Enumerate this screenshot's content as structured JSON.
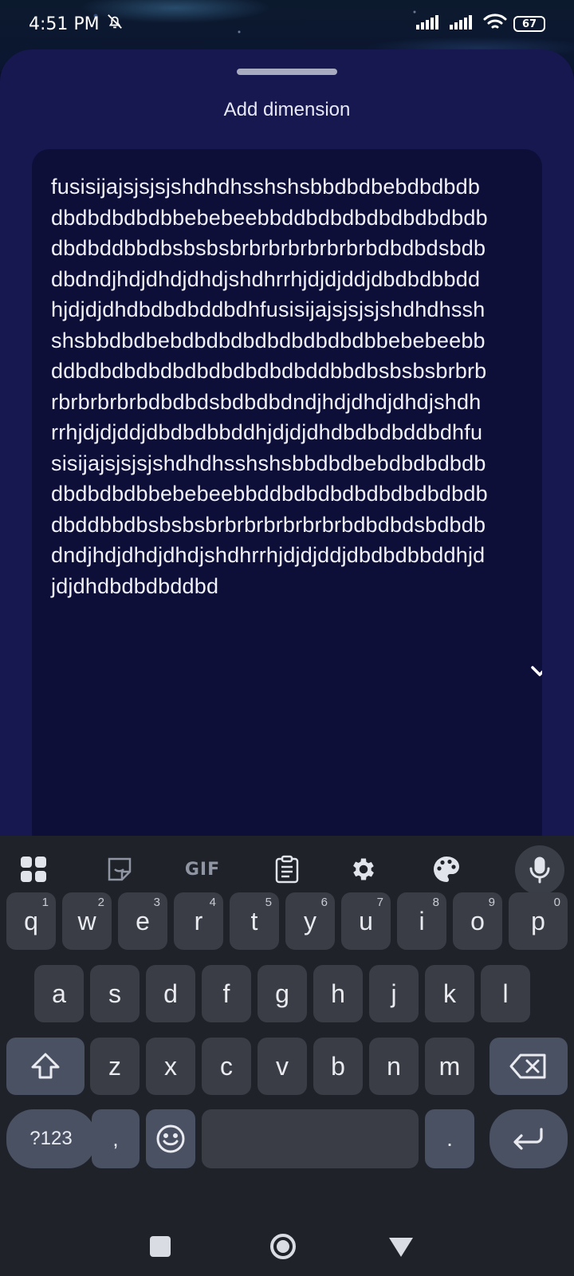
{
  "status_bar": {
    "time": "4:51 PM",
    "battery": "67"
  },
  "sheet": {
    "title": "Add dimension",
    "text_value": "fusisijajsjsjsjshdhdhsshshsbbdbdbebdbdbdbdbdbdbdbdbbebebeebbddbdbdbdbdbdbdbdbdbdbddbbdbsbsbsbrbrbrbrbrbrbrbdbdbdsbdbdbdndjhdjdhdjdhdjshdhrrhjdjdjddjdbdbdbbddhjdjdjdhdbdbdbddbdhfusisijajsjsjsjshdhdhsshshsbbdbdbebdbdbdbdbdbdbdbdbbebebeebbddbdbdbdbdbdbdbdbdbdbddbbdbsbsbsbrbrbrbrbrbrbrbdbdbdsbdbdbdndjhdjdhdjdhdjshdhrrhjdjdjddjdbdbdbbddhjdjdjdhdbdbdbddbdhfusisijajsjsjsjshdhdhsshshsbbdbdbebdbdbdbdbdbdbdbdbbebebeebbddbdbdbdbdbdbdbdbdbdbddbbdbsbsbsbrbrbrbrbrbrbrbdbdbdsbdbdbdndjhdjdhdjdhdjshdhrrhjdjdjddjdbdbdbbddhjdjdjdhdbdbdbddbd"
  },
  "keyboard": {
    "toolbar": [
      "apps-grid-icon",
      "sticker-icon",
      "GIF",
      "clipboard-icon",
      "settings-gear-icon",
      "palette-icon",
      "microphone-icon"
    ],
    "row1": [
      {
        "key": "q",
        "hint": "1"
      },
      {
        "key": "w",
        "hint": "2"
      },
      {
        "key": "e",
        "hint": "3"
      },
      {
        "key": "r",
        "hint": "4"
      },
      {
        "key": "t",
        "hint": "5"
      },
      {
        "key": "y",
        "hint": "6"
      },
      {
        "key": "u",
        "hint": "7"
      },
      {
        "key": "i",
        "hint": "8"
      },
      {
        "key": "o",
        "hint": "9"
      },
      {
        "key": "p",
        "hint": "0"
      }
    ],
    "row2": [
      "a",
      "s",
      "d",
      "f",
      "g",
      "h",
      "j",
      "k",
      "l"
    ],
    "row3": [
      "z",
      "x",
      "c",
      "v",
      "b",
      "n",
      "m"
    ],
    "symbols_label": "?123",
    "comma": ",",
    "period": "."
  },
  "nav_bar": [
    "recents-square-icon",
    "home-circle-icon",
    "back-triangle-icon"
  ]
}
